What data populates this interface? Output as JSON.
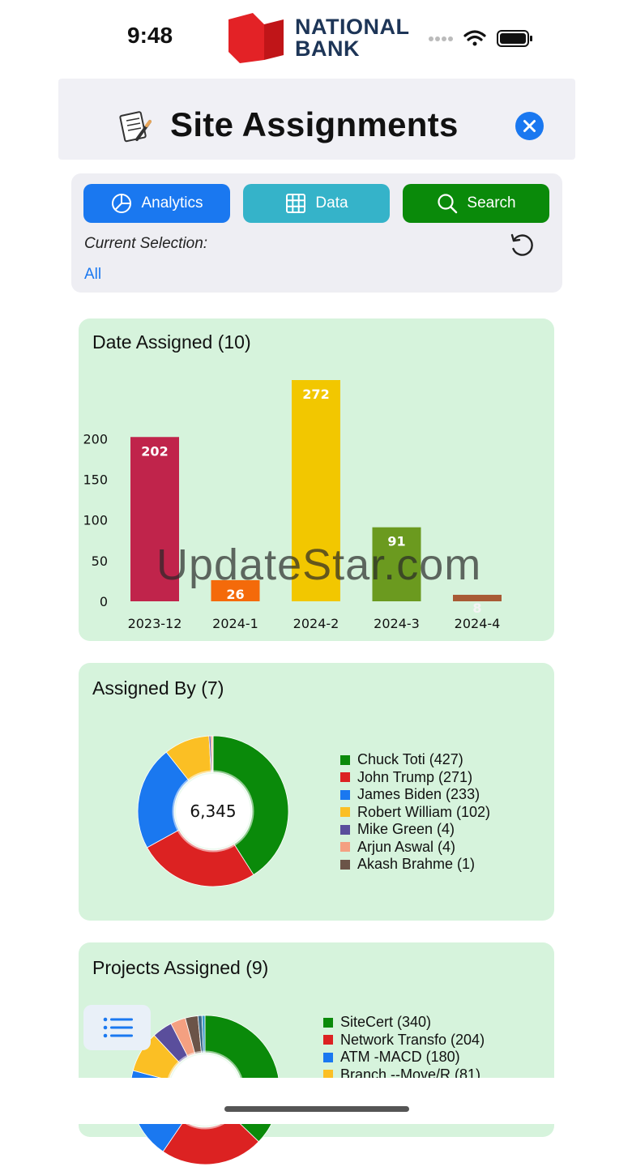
{
  "status_bar": {
    "time": "9:48"
  },
  "brand": {
    "line1": "NATIONAL",
    "line2": "BANK",
    "color": "#e32226"
  },
  "header": {
    "title": "Site Assignments",
    "icon": "memo-icon",
    "close_icon": "close-icon"
  },
  "toolbar": {
    "analytics_label": "Analytics",
    "data_label": "Data",
    "search_label": "Search",
    "current_selection_label": "Current Selection:",
    "current_selection_value": "All"
  },
  "watermark": "UpdateStar.com",
  "chart_data": [
    {
      "type": "bar",
      "title": "Date Assigned (10)",
      "categories": [
        "2023-12",
        "2024-1",
        "2024-2",
        "2024-3",
        "2024-4"
      ],
      "values": [
        202,
        26,
        272,
        91,
        8
      ],
      "colors": [
        "#c0244b",
        "#f46a0a",
        "#f2c700",
        "#6b9a1f",
        "#a85a35"
      ],
      "yticks": [
        0,
        50,
        100,
        150,
        200
      ],
      "ylim": [
        0,
        272
      ],
      "grid": false
    },
    {
      "type": "pie",
      "title": "Assigned By (7)",
      "center_label": "6,345",
      "labels": [
        "Chuck Toti (427)",
        "John Trump (271)",
        "James Biden (233)",
        "Robert William (102)",
        "Mike Green (4)",
        "Arjun Aswal (4)",
        "Akash Brahme (1)"
      ],
      "values": [
        427,
        271,
        233,
        102,
        4,
        4,
        1
      ],
      "colors": [
        "#0a8a0a",
        "#dc2222",
        "#1a78f0",
        "#fbbf24",
        "#5a4e9c",
        "#f4a081",
        "#6b5448"
      ],
      "legend": "right"
    },
    {
      "type": "pie",
      "title": "Projects Assigned (9)",
      "labels": [
        "SiteCert (340)",
        "Network Transfo (204)",
        "ATM -MACD (180)",
        "Branch --Move/R (81)"
      ],
      "values": [
        340,
        204,
        180,
        81
      ],
      "colors": [
        "#0a8a0a",
        "#dc2222",
        "#1a78f0",
        "#fbbf24"
      ],
      "visible_slice_colors": [
        "#0a8a0a",
        "#fbbf24",
        "#5a4e9c",
        "#f4a081",
        "#6b5448",
        "#3a6a8a"
      ],
      "legend": "right"
    }
  ]
}
